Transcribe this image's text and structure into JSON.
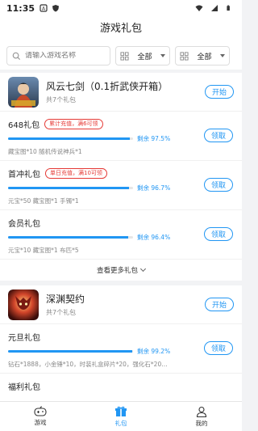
{
  "status": {
    "time": "11:35"
  },
  "header": {
    "title": "游戏礼包"
  },
  "filters": {
    "search_placeholder": "请输入游戏名称",
    "filter1": "全部",
    "filter2": "全部"
  },
  "games": [
    {
      "name": "风云七剑（0.1折武侠开箱）",
      "count": "共7个礼包",
      "button": "开始",
      "icon": "game-icon-swordsman",
      "packages": [
        {
          "name": "648礼包",
          "tag": "累计充值，满6可领",
          "remain": "剩余 97.5%",
          "progress": 97.5,
          "desc": "藏宝图*10 随机传说神兵*1",
          "button": "领取"
        },
        {
          "name": "首冲礼包",
          "tag": "单日充值，满10可领",
          "remain": "剩余 96.7%",
          "progress": 96.7,
          "desc": "元宝*50 藏宝图*1 手镯*1",
          "button": "领取"
        },
        {
          "name": "会员礼包",
          "tag": "",
          "remain": "剩余 96.4%",
          "progress": 96.4,
          "desc": "元宝*10 藏宝图*1 布匹*5",
          "button": "领取"
        }
      ],
      "more": "查看更多礼包"
    },
    {
      "name": "深渊契约",
      "count": "共7个礼包",
      "button": "开始",
      "icon": "game-icon-demon",
      "packages": [
        {
          "name": "元旦礼包",
          "tag": "",
          "remain": "剩余 99.2%",
          "progress": 99.2,
          "desc": "钻石*1888，小金锤*10，时装礼盒碎片*20，强化石*20…",
          "button": "领取"
        },
        {
          "name": "福利礼包",
          "tag": "",
          "remain": "",
          "progress": null,
          "desc": "",
          "button": ""
        }
      ]
    }
  ],
  "tabs": [
    {
      "label": "游戏",
      "icon": "gamepad-icon"
    },
    {
      "label": "礼包",
      "icon": "gift-icon"
    },
    {
      "label": "我的",
      "icon": "user-icon"
    }
  ],
  "colors": {
    "accent": "#2196f3",
    "tag": "#e53935"
  }
}
